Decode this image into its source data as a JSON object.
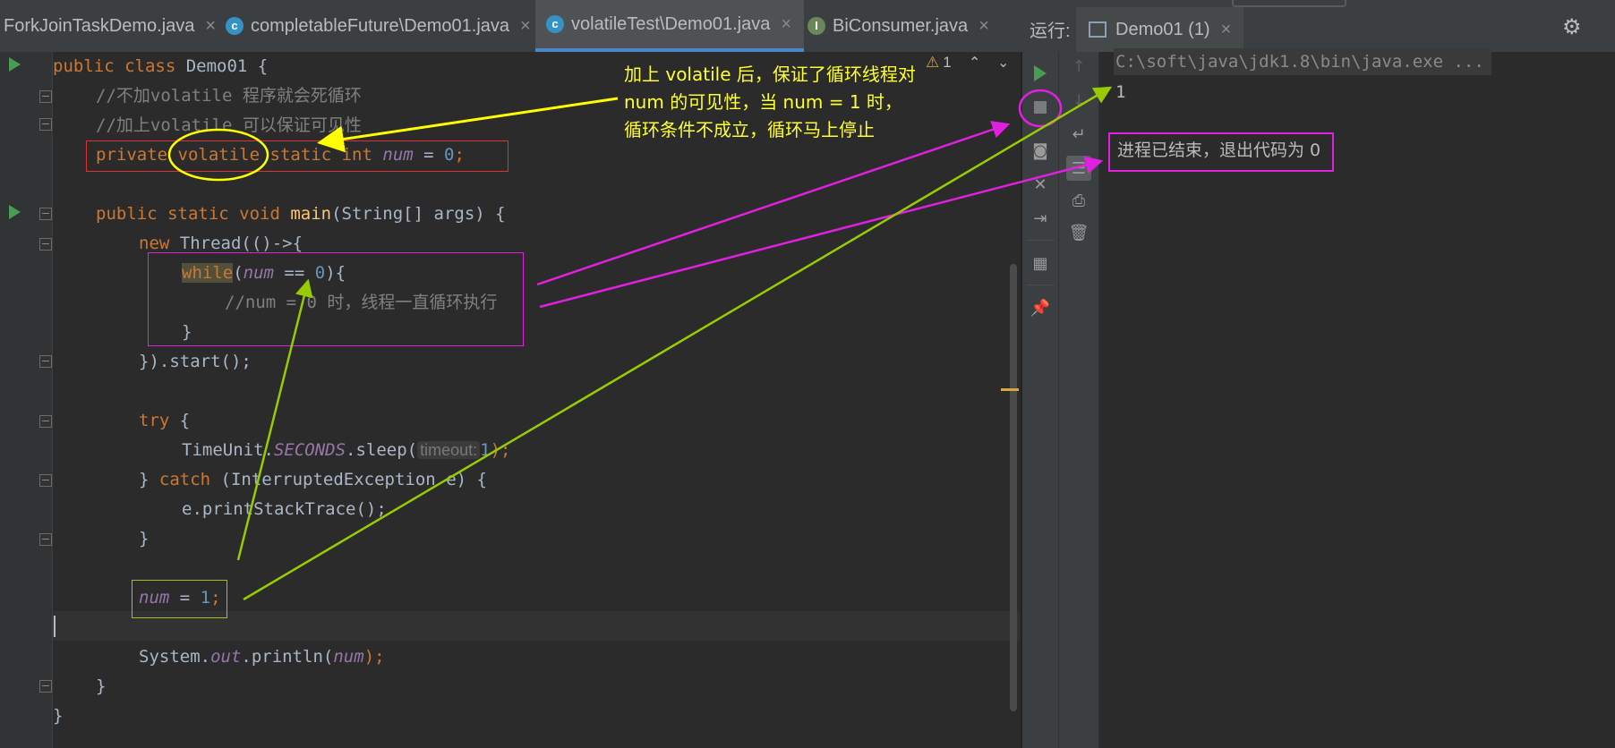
{
  "tabs": [
    {
      "label": "ForkJoinTaskDemo.java",
      "icon": "none",
      "active": false
    },
    {
      "label": "completableFuture\\Demo01.java",
      "icon": "class-icon",
      "active": false
    },
    {
      "label": "volatileTest\\Demo01.java",
      "icon": "class-icon",
      "active": true
    },
    {
      "label": "BiConsumer.java",
      "icon": "interface-icon",
      "active": false
    }
  ],
  "tab_close": "×",
  "editor": {
    "warning_count": "1",
    "code": {
      "l1_public": "public",
      "l1_class": " class ",
      "l1_name": "Demo01 {",
      "l2_comment": "//不加volatile 程序就会死循环",
      "l3_comment": "//加上volatile 可以保证可见性",
      "l4_private": "private",
      "l4_volatile": "volatile",
      "l4_static": "static",
      "l4_int": "int",
      "l4_num": "num",
      "l4_eq": " = ",
      "l4_zero": "0",
      "l4_semi": ";",
      "l6_kw": "public static void ",
      "l6_main": "main",
      "l6_rest": "(String[] args) {",
      "l7_new": "new",
      "l7_rest": " Thread(()->{",
      "l8_while": "while",
      "l8_open": "(",
      "l8_num": "num",
      "l8_eqeq": " == ",
      "l8_zero": "0",
      "l8_close": "){",
      "l9_comment": "//num = 0 时，线程一直循环执行",
      "l10_brace": "}",
      "l11_start": "}).start();",
      "l13_try": "try",
      "l13_brace": " {",
      "l14_a": "TimeUnit.",
      "l14_seconds": "SECONDS",
      "l14_b": ".sleep(",
      "l14_hint": "timeout:",
      "l14_one": "1",
      "l14_c": ");",
      "l15_brace": "} ",
      "l15_catch": "catch",
      "l15_rest": " (InterruptedException e) {",
      "l16": "e.printStackTrace();",
      "l17": "}",
      "l19_num": "num",
      "l19_eq": " = ",
      "l19_one": "1",
      "l19_semi": ";",
      "l21_a": "System.",
      "l21_out": "out",
      "l21_b": ".println(",
      "l21_num": "num",
      "l21_c": ");",
      "l22": "}",
      "l23": "}"
    }
  },
  "run_panel": {
    "label": "运行:",
    "tab": "Demo01 (1)",
    "command": "C:\\soft\\java\\jdk1.8\\bin\\java.exe ...",
    "output": "1",
    "exit_message": "进程已结束，退出代码为 0"
  },
  "annotation": {
    "lines": [
      "加上 volatile 后，保证了循环线程对",
      "num 的可见性，当 num = 1 时，",
      "循环条件不成立，循环马上停止"
    ]
  },
  "colors": {
    "annotation_text": "#ffff33",
    "arrow_yellow": "#ffff00",
    "arrow_magenta": "#e020e0",
    "arrow_green": "#99cc00",
    "box_red": "#e03030"
  }
}
